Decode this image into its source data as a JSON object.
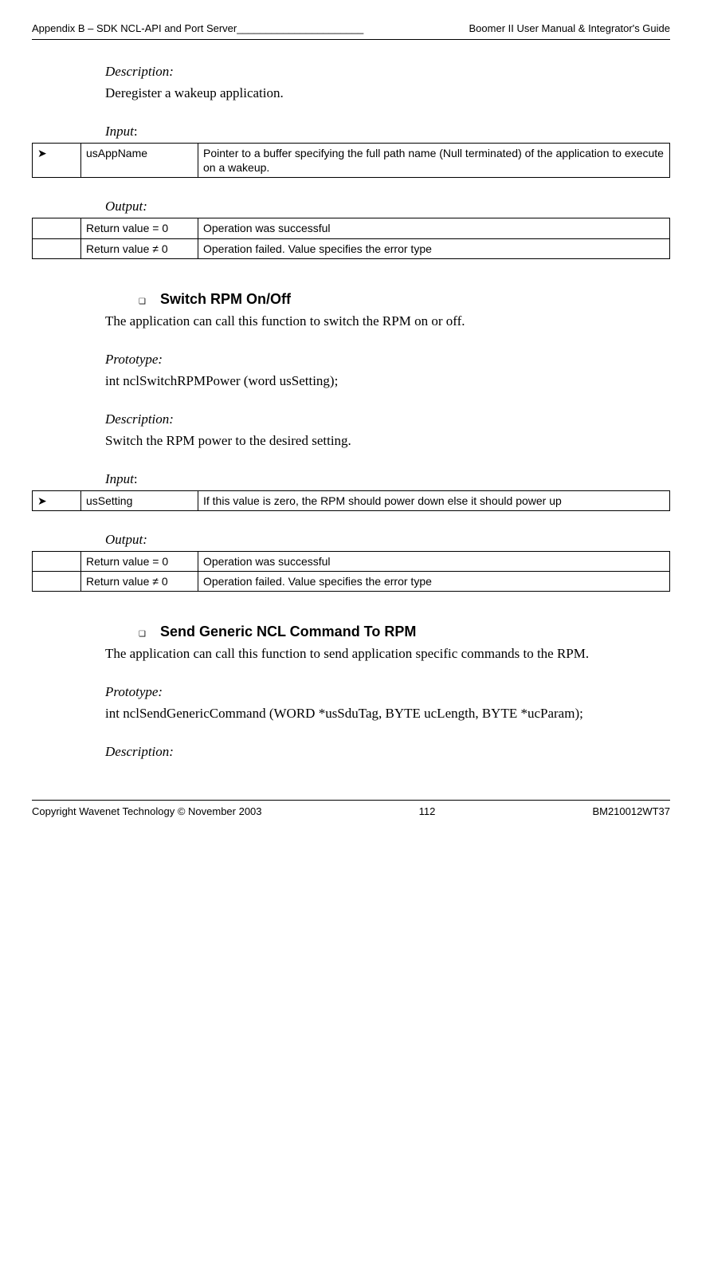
{
  "header": {
    "left": "Appendix B – SDK NCL-API and Port Server______________________",
    "right": "Boomer II User Manual & Integrator's Guide"
  },
  "section1": {
    "desc_label": "Description:",
    "desc_text": "Deregister a wakeup application.",
    "input_label": "Input",
    "input_colon": ":",
    "input_row": {
      "arrow": "➤",
      "name": "usAppName",
      "desc": "Pointer to a buffer specifying the full path name (Null terminated) of the application to execute on a wakeup."
    },
    "output_label": "Output:",
    "out_row1": {
      "arrow": "",
      "name": "Return value = 0",
      "desc": "Operation was successful"
    },
    "out_row2": {
      "arrow": "",
      "name": "Return value  ≠ 0",
      "desc": "Operation failed. Value specifies the error type"
    }
  },
  "section2": {
    "bullet": "❑",
    "heading": "Switch RPM On/Off",
    "intro": "The application can call this function to switch the RPM on or off.",
    "proto_label": "Prototype:",
    "proto_text": "int nclSwitchRPMPower (word usSetting);",
    "desc_label": "Description:",
    "desc_text": "Switch the RPM power to the desired setting.",
    "input_label": "Input",
    "input_colon": ":",
    "input_row": {
      "arrow": "➤",
      "name": "usSetting",
      "desc": "If this value is zero, the RPM should power down else it should power up"
    },
    "output_label": "Output:",
    "out_row1": {
      "arrow": "",
      "name": "Return value = 0",
      "desc": "Operation was successful"
    },
    "out_row2": {
      "arrow": "",
      "name": "Return value  ≠ 0",
      "desc": "Operation failed. Value specifies the error type"
    }
  },
  "section3": {
    "bullet": "❑",
    "heading": "Send Generic NCL Command To RPM",
    "intro": "The application can call this function to send application specific commands to the RPM.",
    "proto_label": "Prototype:",
    "proto_text": "int nclSendGenericCommand (WORD *usSduTag, BYTE ucLength, BYTE *ucParam);",
    "desc_label": "Description:"
  },
  "footer": {
    "left": "Copyright Wavenet Technology © November 2003",
    "center": "112",
    "right": "BM210012WT37"
  }
}
